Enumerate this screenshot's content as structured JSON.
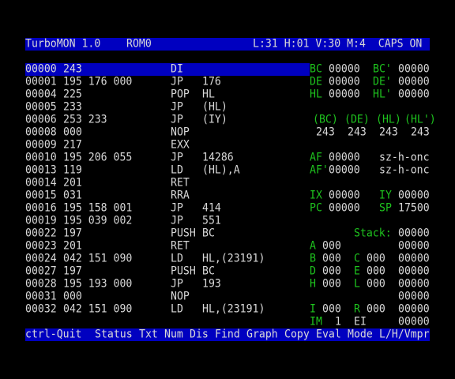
{
  "status_bar": {
    "title": "TurboMON 1.0",
    "rom": "ROM0",
    "status": "L:31 H:01 V:30 M:4  CAPS ON"
  },
  "disassembly": [
    {
      "addr": "00000",
      "bytes": "243",
      "mnemonic": "DI",
      "operand": ""
    },
    {
      "addr": "00001",
      "bytes": "195 176 000",
      "mnemonic": "JP",
      "operand": "176"
    },
    {
      "addr": "00004",
      "bytes": "225",
      "mnemonic": "POP",
      "operand": "HL"
    },
    {
      "addr": "00005",
      "bytes": "233",
      "mnemonic": "JP",
      "operand": "(HL)"
    },
    {
      "addr": "00006",
      "bytes": "253 233",
      "mnemonic": "JP",
      "operand": "(IY)"
    },
    {
      "addr": "00008",
      "bytes": "000",
      "mnemonic": "NOP",
      "operand": ""
    },
    {
      "addr": "00009",
      "bytes": "217",
      "mnemonic": "EXX",
      "operand": ""
    },
    {
      "addr": "00010",
      "bytes": "195 206 055",
      "mnemonic": "JP",
      "operand": "14286"
    },
    {
      "addr": "00013",
      "bytes": "119",
      "mnemonic": "LD",
      "operand": "(HL),A"
    },
    {
      "addr": "00014",
      "bytes": "201",
      "mnemonic": "RET",
      "operand": ""
    },
    {
      "addr": "00015",
      "bytes": "031",
      "mnemonic": "RRA",
      "operand": ""
    },
    {
      "addr": "00016",
      "bytes": "195 158 001",
      "mnemonic": "JP",
      "operand": "414"
    },
    {
      "addr": "00019",
      "bytes": "195 039 002",
      "mnemonic": "JP",
      "operand": "551"
    },
    {
      "addr": "00022",
      "bytes": "197",
      "mnemonic": "PUSH",
      "operand": "BC"
    },
    {
      "addr": "00023",
      "bytes": "201",
      "mnemonic": "RET",
      "operand": ""
    },
    {
      "addr": "00024",
      "bytes": "042 151 090",
      "mnemonic": "LD",
      "operand": "HL,(23191)"
    },
    {
      "addr": "00027",
      "bytes": "197",
      "mnemonic": "PUSH",
      "operand": "BC"
    },
    {
      "addr": "00028",
      "bytes": "195 193 000",
      "mnemonic": "JP",
      "operand": "193"
    },
    {
      "addr": "00031",
      "bytes": "000",
      "mnemonic": "NOP",
      "operand": ""
    },
    {
      "addr": "00032",
      "bytes": "042 151 090",
      "mnemonic": "LD",
      "operand": "HL,(23191)"
    }
  ],
  "registers": {
    "bc": {
      "label": "BC",
      "value": "00000"
    },
    "bc_alt": {
      "label": "BC'",
      "value": "00000"
    },
    "de": {
      "label": "DE",
      "value": "00000"
    },
    "de_alt": {
      "label": "DE'",
      "value": "00000"
    },
    "hl": {
      "label": "HL",
      "value": "00000"
    },
    "hl_alt": {
      "label": "HL'",
      "value": "00000"
    },
    "indirect": [
      {
        "label": "(BC)",
        "value": "243"
      },
      {
        "label": "(DE)",
        "value": "243"
      },
      {
        "label": "(HL)",
        "value": "243"
      },
      {
        "label": "(HL')",
        "value": "243"
      }
    ],
    "af": {
      "label": "AF",
      "value": "00000",
      "flags": "sz-h-onc"
    },
    "af_alt": {
      "label": "AF'",
      "value": "00000",
      "flags": "sz-h-onc"
    },
    "ix": {
      "label": "IX",
      "value": "00000"
    },
    "iy": {
      "label": "IY",
      "value": "00000"
    },
    "pc": {
      "label": "PC",
      "value": "00000"
    },
    "sp": {
      "label": "SP",
      "value": "17500"
    },
    "stack_label": "Stack:",
    "stack": [
      "00000",
      "00000",
      "00000",
      "00000",
      "00000",
      "00000",
      "00000",
      "00000"
    ],
    "a": {
      "label": "A",
      "value": "000"
    },
    "b": {
      "label": "B",
      "value": "000"
    },
    "c": {
      "label": "C",
      "value": "000"
    },
    "d": {
      "label": "D",
      "value": "000"
    },
    "e": {
      "label": "E",
      "value": "000"
    },
    "h": {
      "label": "H",
      "value": "000"
    },
    "l": {
      "label": "L",
      "value": "000"
    },
    "i": {
      "label": "I",
      "value": "000"
    },
    "r": {
      "label": "R",
      "value": "000"
    },
    "im": {
      "label": "IM",
      "value": "1"
    },
    "ei": "EI"
  },
  "menu": {
    "quit": "ctrl-Quit",
    "items": [
      "Status",
      "Txt",
      "Num",
      "Dis",
      "Find",
      "Graph",
      "Copy",
      "Eval",
      "Mode",
      "L/H/Vmpr"
    ]
  }
}
